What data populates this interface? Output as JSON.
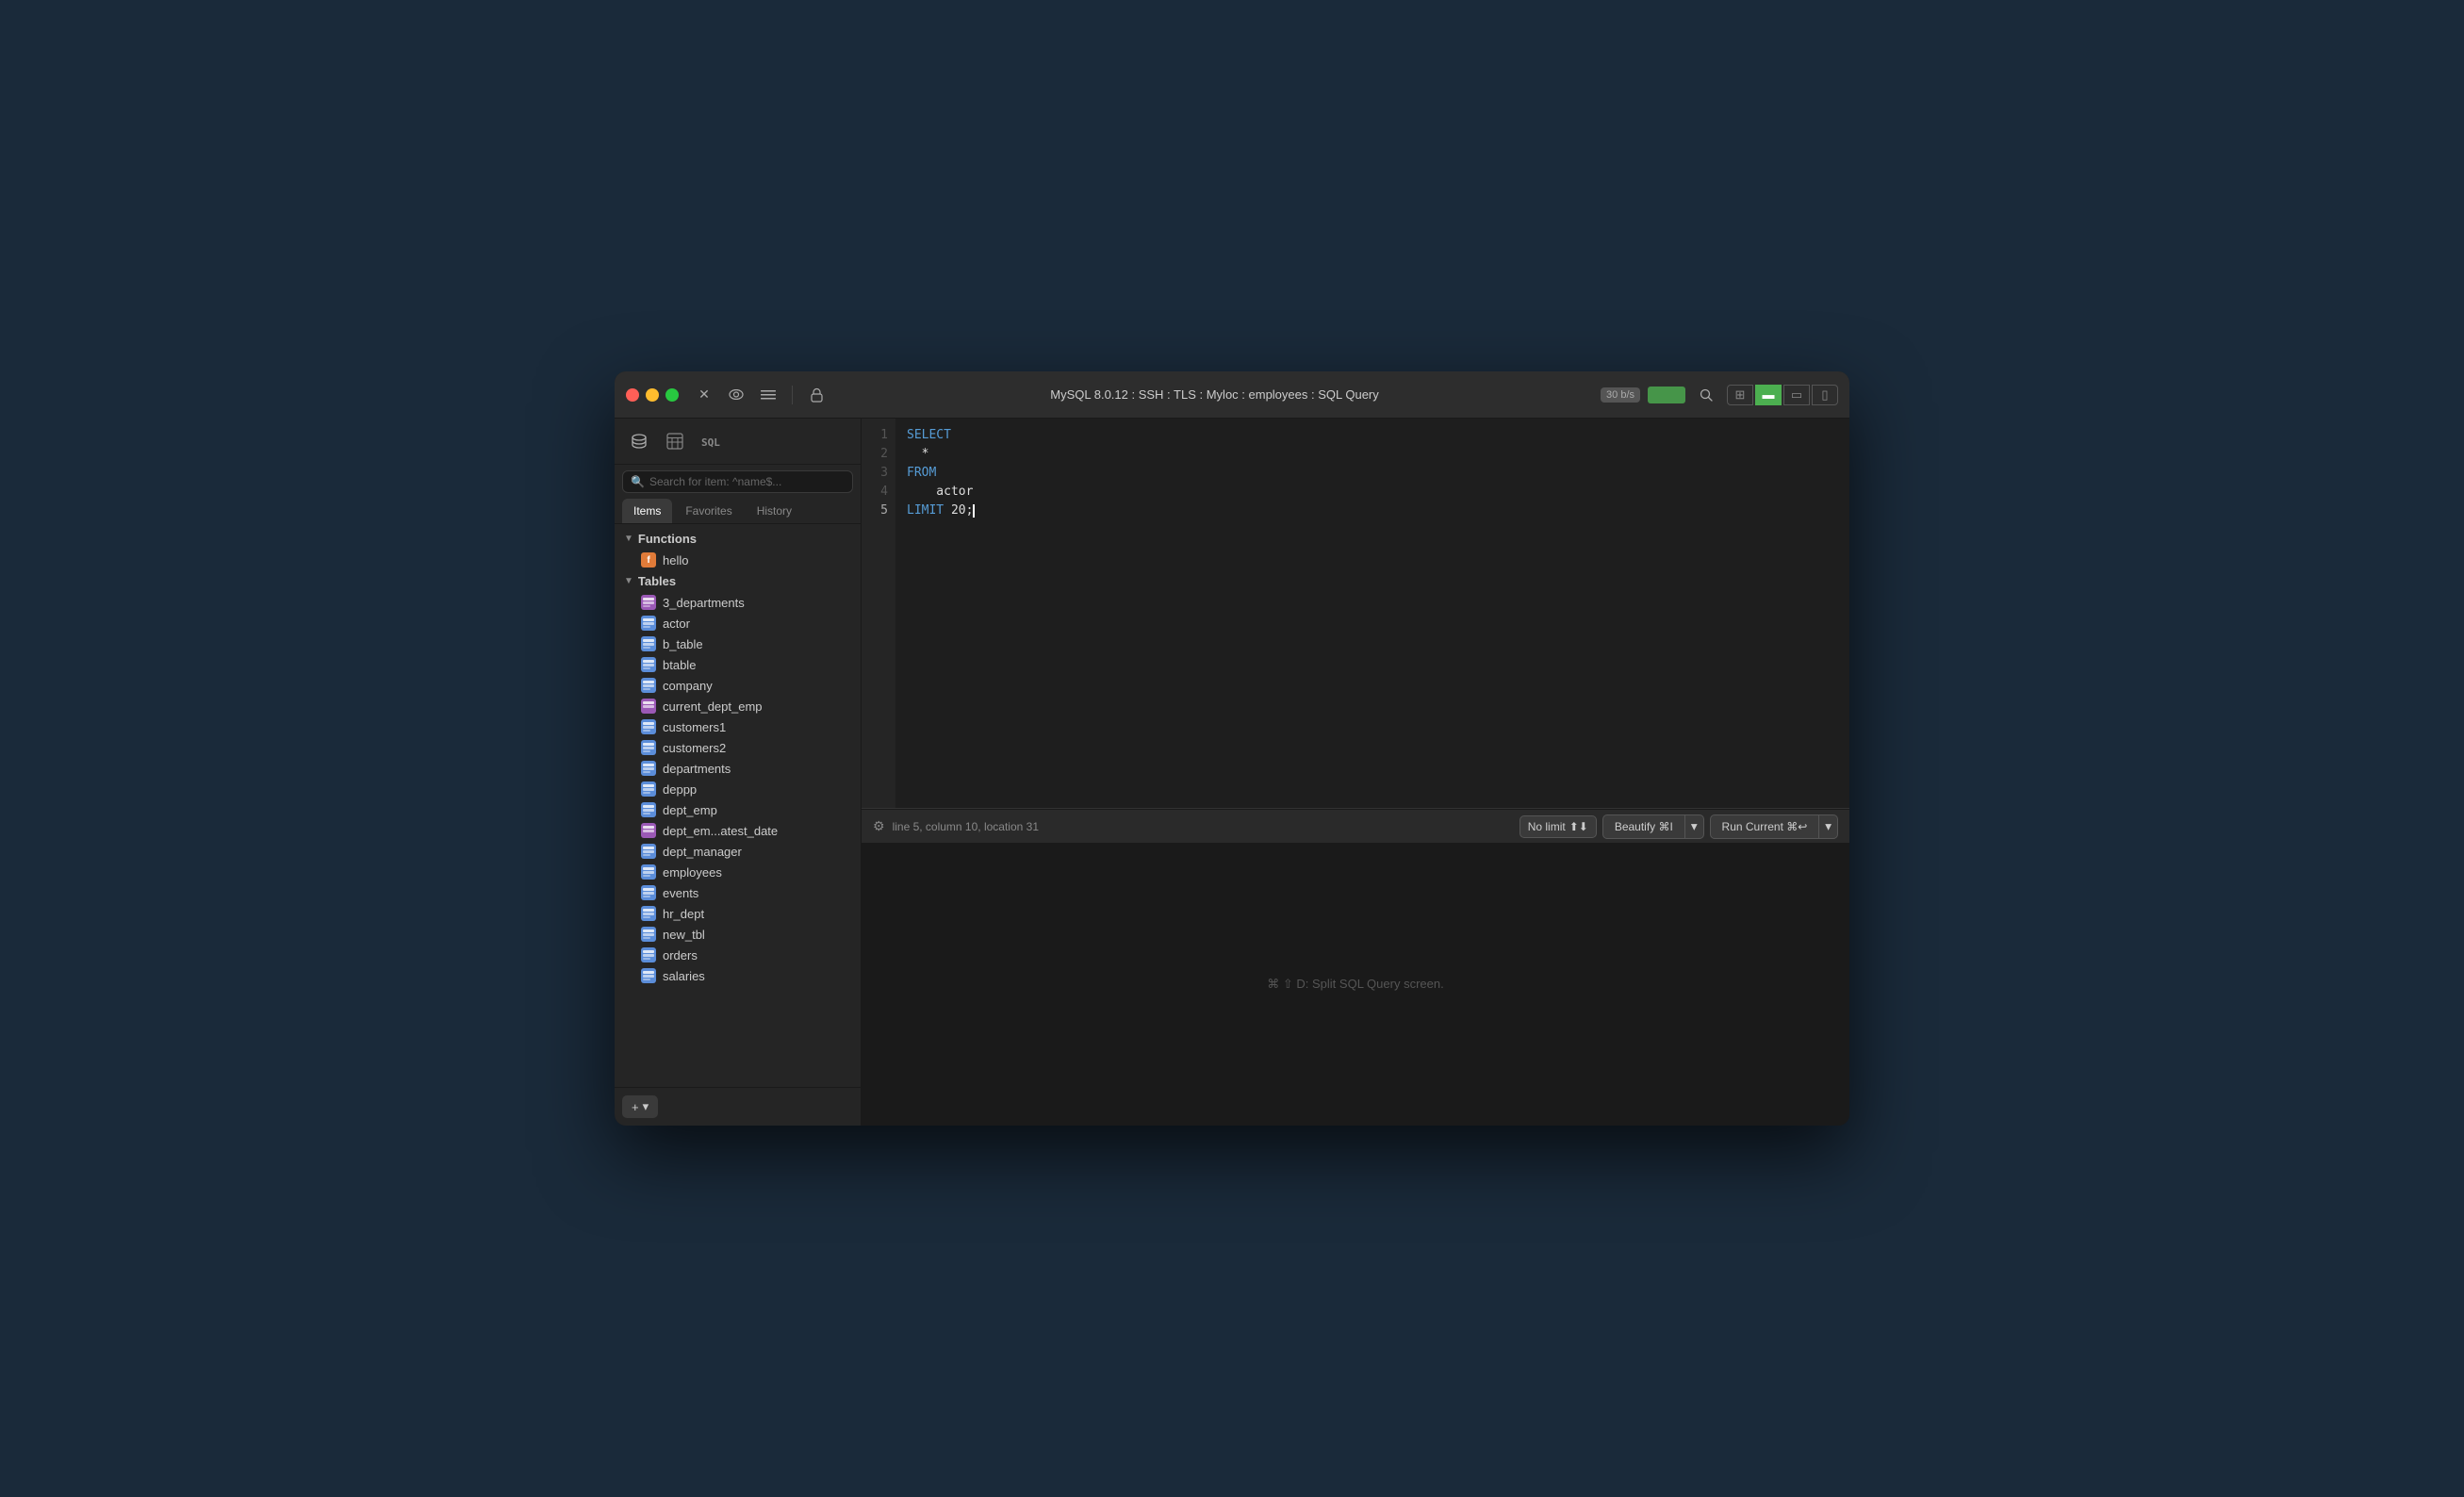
{
  "window": {
    "title": "MySQL 8.0.12 : SSH : TLS : Myloc : employees : SQL Query",
    "speed": "30 b/s"
  },
  "titlebar": {
    "traffic_lights": [
      "red",
      "yellow",
      "green"
    ],
    "icons": [
      {
        "name": "stop-icon",
        "symbol": "✕"
      },
      {
        "name": "eye-icon",
        "symbol": "👁"
      },
      {
        "name": "list-icon",
        "symbol": "≡"
      },
      {
        "name": "lock-icon",
        "symbol": "🔒"
      }
    ],
    "right_icons": [
      {
        "name": "search-icon",
        "symbol": "🔍"
      },
      {
        "name": "grid-icon",
        "symbol": "⊞"
      },
      {
        "name": "view1-icon",
        "symbol": "▬"
      },
      {
        "name": "view2-icon",
        "symbol": "▭"
      },
      {
        "name": "view3-icon",
        "symbol": "▯"
      }
    ]
  },
  "sidebar": {
    "search_placeholder": "Search for item: ^name$...",
    "tabs": [
      {
        "label": "Items",
        "active": true
      },
      {
        "label": "Favorites",
        "active": false
      },
      {
        "label": "History",
        "active": false
      }
    ],
    "functions_section": {
      "label": "Functions",
      "expanded": true,
      "items": [
        {
          "name": "hello",
          "icon_type": "orange",
          "icon_text": "f"
        }
      ]
    },
    "tables_section": {
      "label": "Tables",
      "expanded": true,
      "items": [
        {
          "name": "3_departments",
          "icon_type": "purple"
        },
        {
          "name": "actor",
          "icon_type": "grid"
        },
        {
          "name": "b_table",
          "icon_type": "grid"
        },
        {
          "name": "btable",
          "icon_type": "grid"
        },
        {
          "name": "company",
          "icon_type": "grid"
        },
        {
          "name": "current_dept_emp",
          "icon_type": "purple"
        },
        {
          "name": "customers1",
          "icon_type": "grid"
        },
        {
          "name": "customers2",
          "icon_type": "grid"
        },
        {
          "name": "departments",
          "icon_type": "grid"
        },
        {
          "name": "deppp",
          "icon_type": "grid"
        },
        {
          "name": "dept_emp",
          "icon_type": "grid"
        },
        {
          "name": "dept_em...atest_date",
          "icon_type": "purple"
        },
        {
          "name": "dept_manager",
          "icon_type": "grid"
        },
        {
          "name": "employees",
          "icon_type": "grid"
        },
        {
          "name": "events",
          "icon_type": "grid"
        },
        {
          "name": "hr_dept",
          "icon_type": "grid"
        },
        {
          "name": "new_tbl",
          "icon_type": "grid"
        },
        {
          "name": "orders",
          "icon_type": "grid"
        },
        {
          "name": "salaries",
          "icon_type": "grid"
        }
      ]
    },
    "add_button": "+",
    "dropdown_button": "▾"
  },
  "editor": {
    "lines": [
      {
        "num": "1",
        "content": "SELECT",
        "type": "keyword"
      },
      {
        "num": "2",
        "content": "  *",
        "type": "text"
      },
      {
        "num": "3",
        "content": "FROM",
        "type": "keyword"
      },
      {
        "num": "4",
        "content": "    actor",
        "type": "text"
      },
      {
        "num": "5",
        "content": "LIMIT 20;",
        "type": "keyword_mixed"
      }
    ]
  },
  "statusbar": {
    "position_text": "line 5, column 10, location 31",
    "no_limit_label": "No limit",
    "beautify_label": "Beautify ⌘I",
    "run_label": "Run Current ⌘↩"
  },
  "split_hint": "⌘ ⇧ D: Split SQL Query screen."
}
